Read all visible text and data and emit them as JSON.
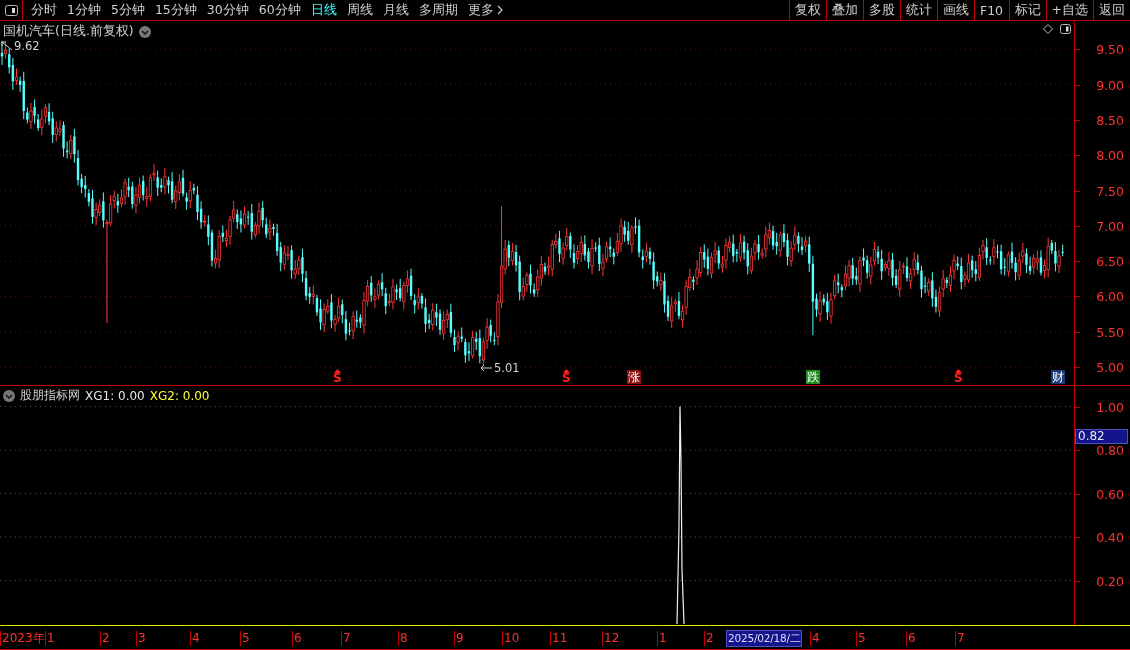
{
  "toolbar": {
    "period_tabs": [
      {
        "label": "分时",
        "selected": false
      },
      {
        "label": "1分钟",
        "selected": false
      },
      {
        "label": "5分钟",
        "selected": false
      },
      {
        "label": "15分钟",
        "selected": false
      },
      {
        "label": "30分钟",
        "selected": false
      },
      {
        "label": "60分钟",
        "selected": false
      },
      {
        "label": "日线",
        "selected": true
      },
      {
        "label": "周线",
        "selected": false
      },
      {
        "label": "月线",
        "selected": false
      },
      {
        "label": "多周期",
        "selected": false
      },
      {
        "label": "更多",
        "selected": false
      }
    ],
    "actions": [
      "复权",
      "叠加",
      "多股",
      "统计",
      "画线",
      "F10",
      "标记",
      "+自选",
      "返回"
    ]
  },
  "main_chart": {
    "title": "国机汽车(日线.前复权)",
    "high_label": "9.62",
    "low_label": "5.01",
    "y_ticks": [
      "9.50",
      "9.00",
      "8.50",
      "8.00",
      "7.50",
      "7.00",
      "6.50",
      "6.00",
      "5.50",
      "5.00"
    ],
    "event_marks": [
      {
        "kind": "s",
        "label": "S"
      },
      {
        "kind": "s",
        "label": "S"
      },
      {
        "kind": "tag",
        "label": "涨",
        "color": "#8b1010"
      },
      {
        "kind": "tag",
        "label": "跌",
        "color": "#1e8c1e"
      },
      {
        "kind": "s",
        "label": "S"
      },
      {
        "kind": "tag",
        "label": "财",
        "color": "#1c3a78"
      }
    ]
  },
  "indicator": {
    "name": "股朋指标网",
    "series": [
      {
        "label": "XG1: 0.00",
        "color": "#e6e6e6"
      },
      {
        "label": "XG2: 0.00",
        "color": "#ffff33"
      }
    ],
    "y_ticks": [
      "1.00",
      "0.80",
      "0.60",
      "0.40",
      "0.20"
    ],
    "cursor_value": "0.82"
  },
  "date_axis": [
    {
      "label": "2023年",
      "selected": false
    },
    {
      "label": "1",
      "selected": false
    },
    {
      "label": "2",
      "selected": false
    },
    {
      "label": "3",
      "selected": false
    },
    {
      "label": "4",
      "selected": false
    },
    {
      "label": "5",
      "selected": false
    },
    {
      "label": "6",
      "selected": false
    },
    {
      "label": "7",
      "selected": false
    },
    {
      "label": "8",
      "selected": false
    },
    {
      "label": "9",
      "selected": false
    },
    {
      "label": "10",
      "selected": false
    },
    {
      "label": "11",
      "selected": false
    },
    {
      "label": "12",
      "selected": false
    },
    {
      "label": "1",
      "selected": false
    },
    {
      "label": "2",
      "selected": false
    },
    {
      "label": "2025/02/18/二",
      "selected": true
    },
    {
      "label": "4",
      "selected": false
    },
    {
      "label": "5",
      "selected": false
    },
    {
      "label": "6",
      "selected": false
    },
    {
      "label": "7",
      "selected": false
    }
  ]
}
